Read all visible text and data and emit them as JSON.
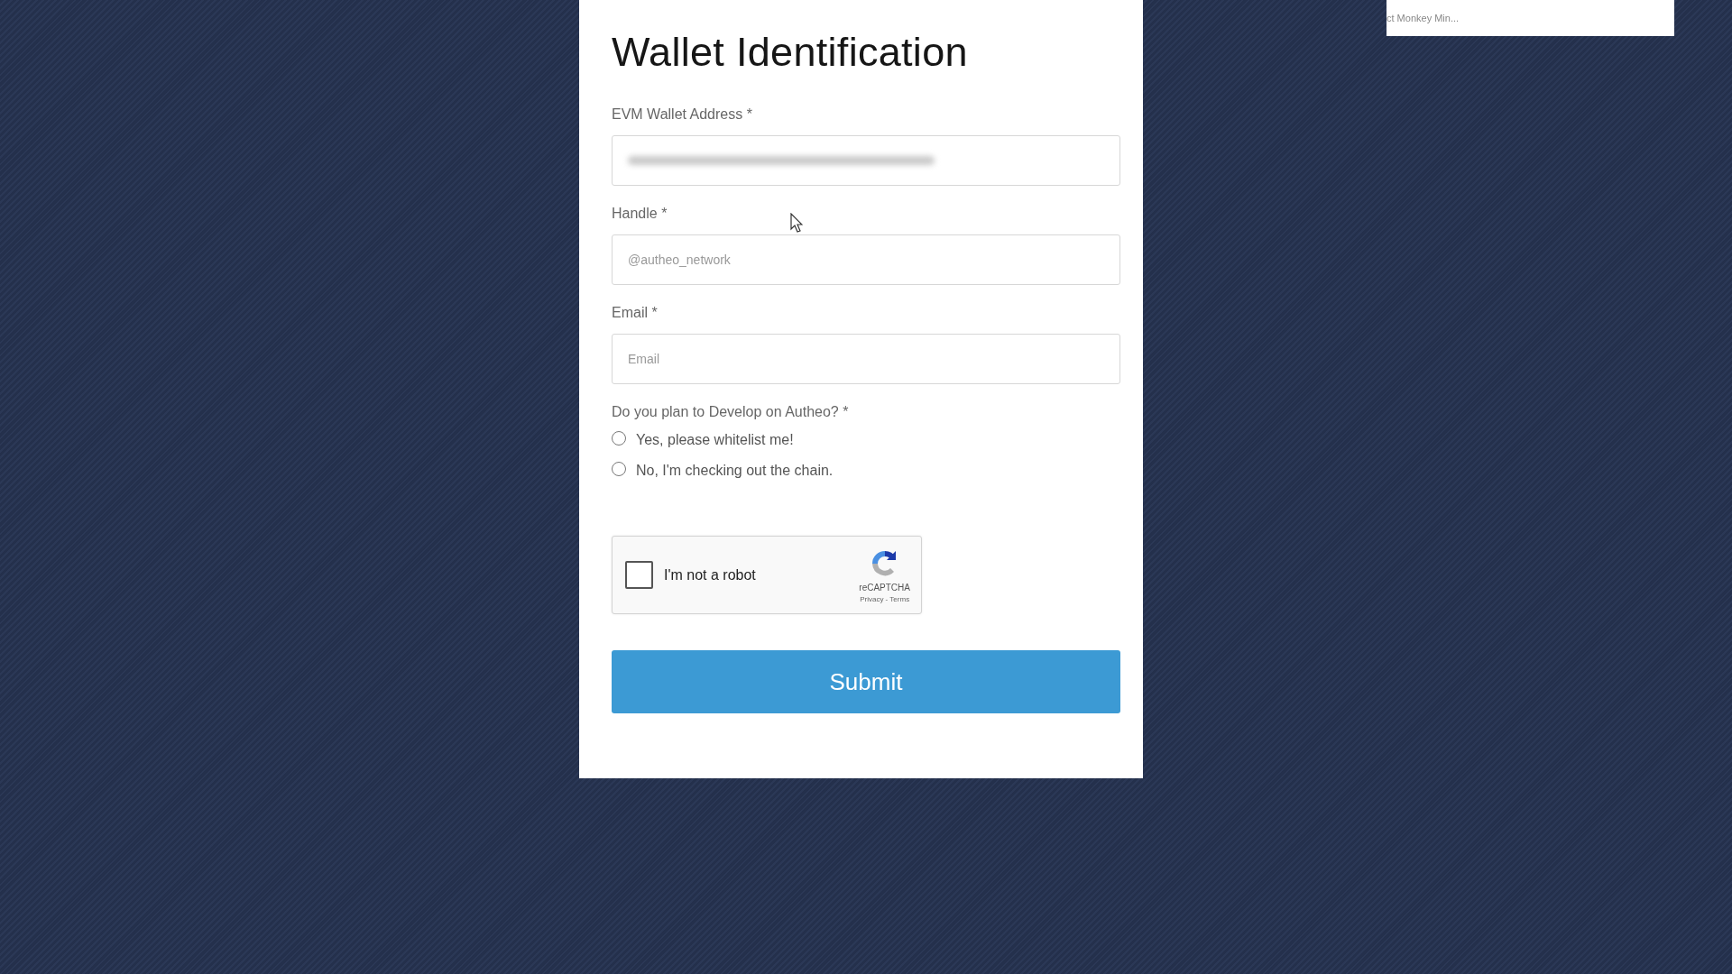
{
  "notice": {
    "text": "ct Monkey Min..."
  },
  "form": {
    "title": "Wallet Identification",
    "fields": [
      {
        "kind": "redacted",
        "label": "EVM Wallet Address *"
      },
      {
        "kind": "text",
        "label": "Handle *",
        "placeholder": "@autheo_network"
      },
      {
        "kind": "text",
        "label": "Email *",
        "placeholder": "Email"
      }
    ],
    "question": {
      "label": "Do you plan to Develop on Autheo? *",
      "options": [
        {
          "label": "Yes, please whitelist me!",
          "selected": false
        },
        {
          "label": "No, I'm checking out the chain.",
          "selected": false
        }
      ]
    },
    "captcha": {
      "label": "I'm not a robot",
      "checked": false,
      "brand": "reCAPTCHA",
      "links": "Privacy - Terms"
    },
    "submit": "Submit"
  }
}
